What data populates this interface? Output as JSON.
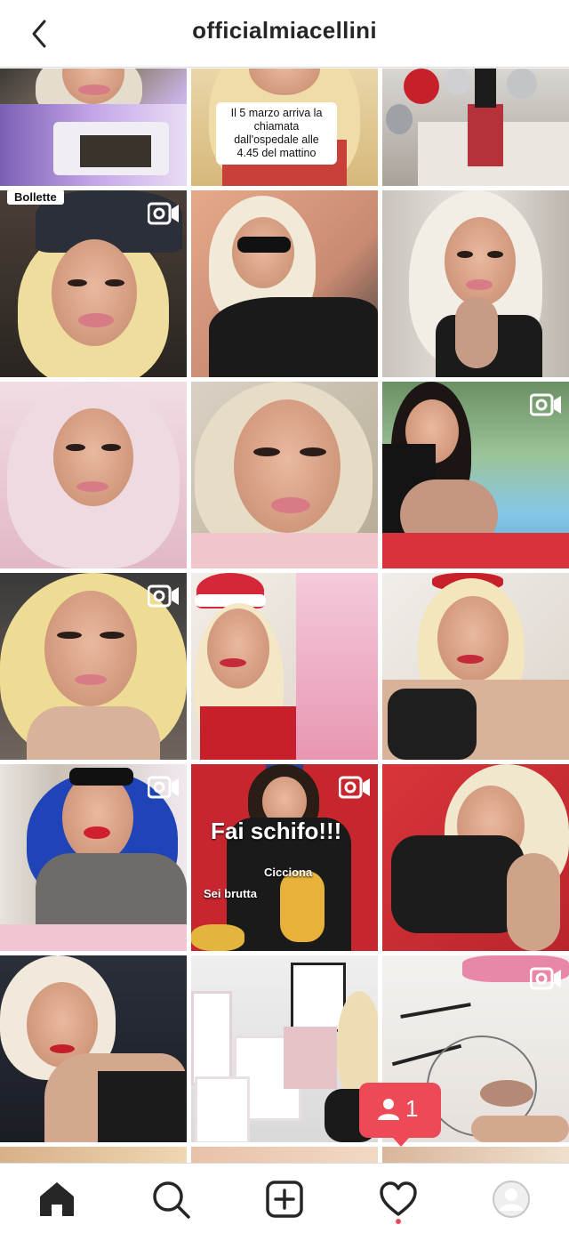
{
  "header": {
    "title": "officialmiacellini",
    "back_icon": "chevron-left-icon"
  },
  "grid": {
    "captions": {
      "tile2_text": "Il 5 marzo arriva la chiamata dall'ospedale alle 4.45 del mattino",
      "tile4_label": "Bollette",
      "tile14_big": "Fai schifo!!!",
      "tile14_name": "Cicciona",
      "tile14_sub": "Sei brutta"
    },
    "video_icon": "video-camera-icon"
  },
  "notification": {
    "count": "1",
    "icon": "person-icon",
    "color": "#ed4956"
  },
  "tabbar": {
    "items": [
      "home-icon",
      "search-icon",
      "new-post-icon",
      "heart-icon",
      "profile-avatar"
    ]
  }
}
